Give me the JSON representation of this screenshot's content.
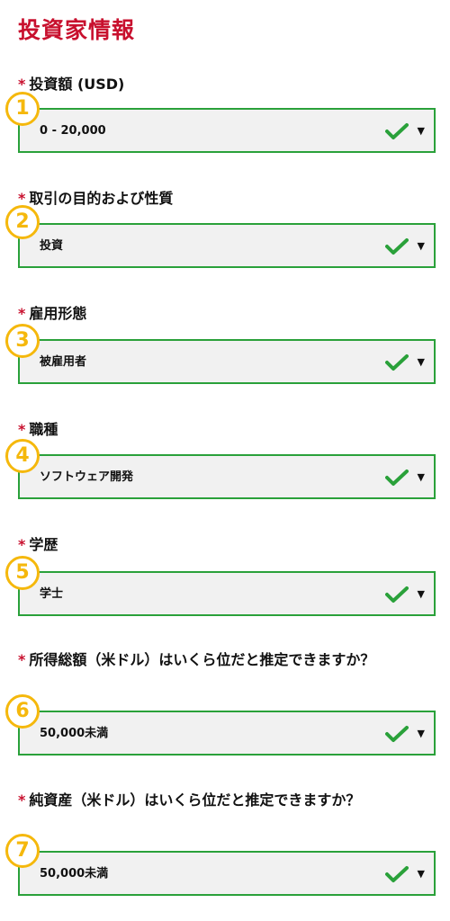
{
  "page": {
    "title": "投資家情報"
  },
  "required_mark": "*",
  "fields": [
    {
      "number": "1",
      "label": "投資額 (USD)",
      "value": "0 - 20,000"
    },
    {
      "number": "2",
      "label": "取引の目的および性質",
      "value": "投資"
    },
    {
      "number": "3",
      "label": "雇用形態",
      "value": "被雇用者"
    },
    {
      "number": "4",
      "label": "職種",
      "value": "ソフトウェア開発"
    },
    {
      "number": "5",
      "label": "学歴",
      "value": "学士"
    },
    {
      "number": "6",
      "label": "所得総額（米ドル）はいくら位だと推定できますか？",
      "value": "50,000未満"
    },
    {
      "number": "7",
      "label": "純資産（米ドル）はいくら位だと推定できますか？",
      "value": "50,000未満"
    }
  ],
  "icons": {
    "valid": "checkmark-icon",
    "dropdown": "caret-down-icon"
  },
  "colors": {
    "accent_red": "#c8102e",
    "valid_green": "#2aa13a",
    "badge_yellow": "#f5b80c",
    "field_bg": "#f1f1f1"
  }
}
